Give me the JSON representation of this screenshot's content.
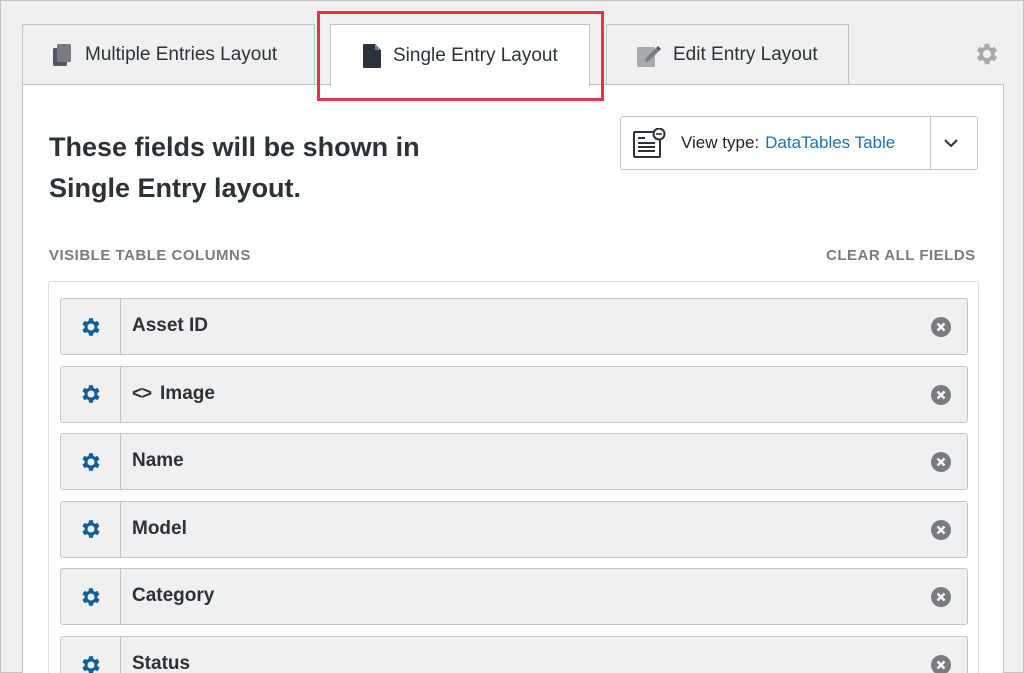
{
  "tabs": [
    {
      "label": "Multiple Entries Layout",
      "icon": "multiple-pages-icon",
      "active": false
    },
    {
      "label": "Single Entry Layout",
      "icon": "single-page-icon",
      "active": true
    },
    {
      "label": "Edit Entry Layout",
      "icon": "edit-page-icon",
      "active": false
    }
  ],
  "settings_icon": "gear-icon",
  "panel": {
    "heading": "These fields will be shown in Single Entry layout.",
    "view_type": {
      "label": "View type:",
      "value": "DataTables Table",
      "icon": "datatables-icon",
      "chevron": "chevron-down-icon"
    },
    "visible_columns_label": "VISIBLE TABLE COLUMNS",
    "clear_all_label": "CLEAR ALL FIELDS",
    "fields": [
      {
        "label": "Asset ID",
        "code_prefix": ""
      },
      {
        "label": "Image",
        "code_prefix": "<>"
      },
      {
        "label": "Name",
        "code_prefix": ""
      },
      {
        "label": "Model",
        "code_prefix": ""
      },
      {
        "label": "Category",
        "code_prefix": ""
      },
      {
        "label": "Status",
        "code_prefix": ""
      }
    ]
  },
  "colors": {
    "accent_blue": "#2271b1",
    "gear_blue": "#135e96",
    "highlight_red": "#e3324a",
    "text_dark": "#2c3338",
    "muted": "#787c82"
  }
}
